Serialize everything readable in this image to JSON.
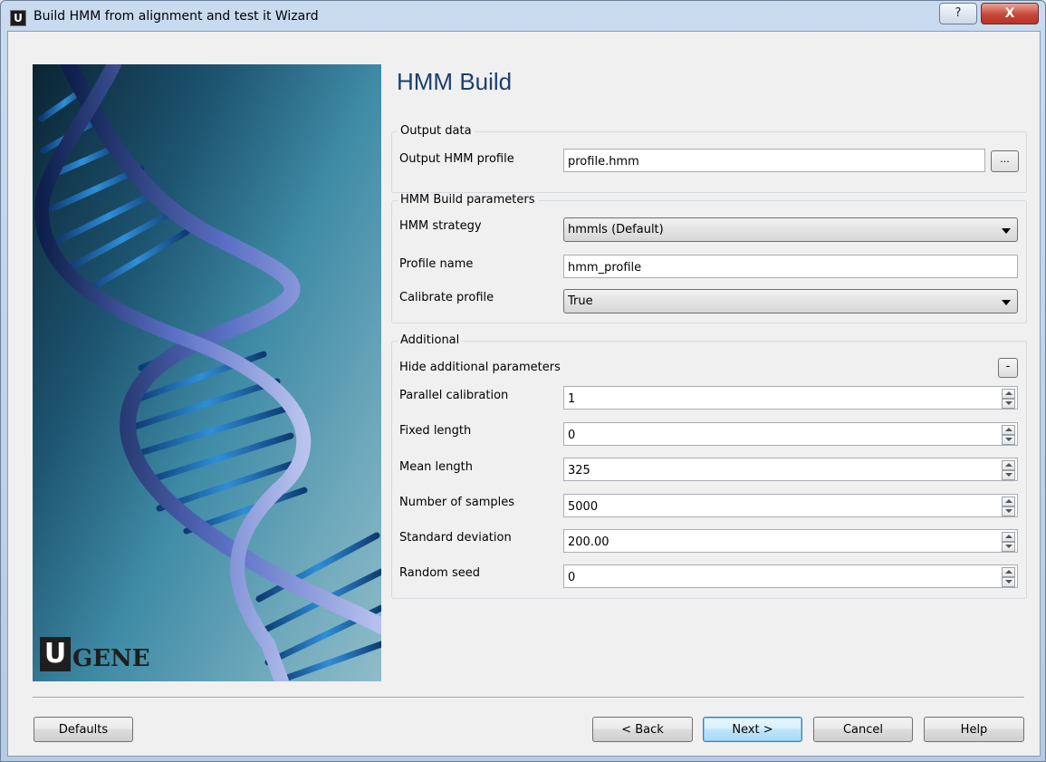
{
  "window": {
    "app_icon_letter": "U",
    "title": "Build HMM from alignment and test it Wizard",
    "help_glyph": "?",
    "close_glyph": "X"
  },
  "logo": {
    "u": "U",
    "gene": "GENE"
  },
  "page_title": "HMM Build",
  "output_data": {
    "group_title": "Output data",
    "profile_label": "Output HMM profile",
    "profile_value": "profile.hmm",
    "browse_label": "..."
  },
  "build_params": {
    "group_title": "HMM Build parameters",
    "strategy_label": "HMM strategy",
    "strategy_value": "hmmls (Default)",
    "name_label": "Profile name",
    "name_value": "hmm_profile",
    "calibrate_label": "Calibrate profile",
    "calibrate_value": "True"
  },
  "additional": {
    "group_title": "Additional",
    "toggle_label": "Hide additional parameters",
    "toggle_button": "-",
    "fields": [
      {
        "label": "Parallel calibration",
        "value": "1"
      },
      {
        "label": "Fixed length",
        "value": "0"
      },
      {
        "label": "Mean length",
        "value": "325"
      },
      {
        "label": "Number of samples",
        "value": "5000"
      },
      {
        "label": "Standard deviation",
        "value": "200.00"
      },
      {
        "label": "Random seed",
        "value": "0"
      }
    ]
  },
  "buttons": {
    "defaults": "Defaults",
    "back": "< Back",
    "next": "Next >",
    "cancel": "Cancel",
    "help": "Help"
  }
}
